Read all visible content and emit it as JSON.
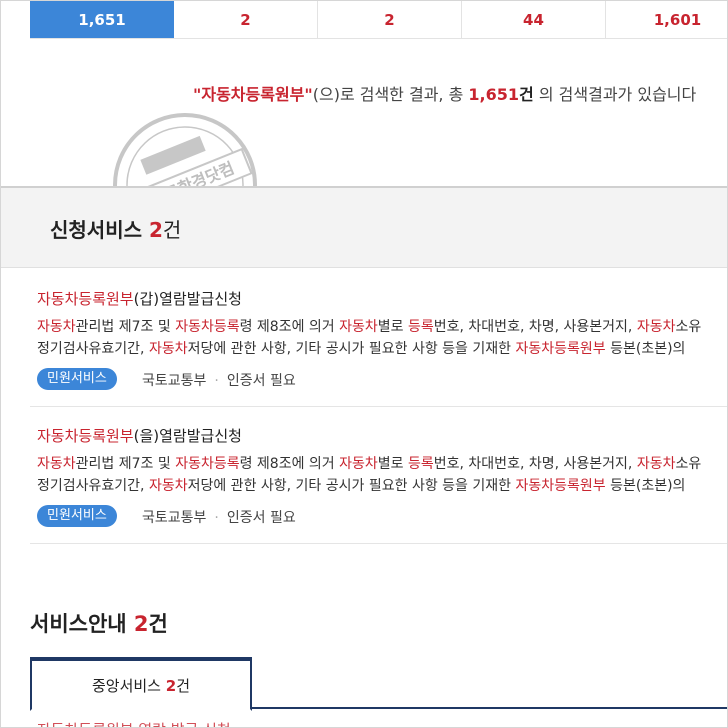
{
  "count_tabs": [
    "1,651",
    "2",
    "2",
    "44",
    "1,601"
  ],
  "summary": {
    "quote_open": "\"",
    "keyword": "자동차등록원부",
    "quote_close": "\"",
    "text1": "(으)로 검색한 결과, 총 ",
    "total": "1,651",
    "unit": "건",
    "text2": " 의 검색결과가 있습니다"
  },
  "watermark_text": "블로그한경닷컴",
  "apply_section": {
    "title": "신청서비스",
    "count": "2",
    "unit": "건"
  },
  "items": [
    {
      "title_hl": "자동차등록원부",
      "title_rest": "(갑)열람발급신청",
      "line1": [
        {
          "t": "자동차",
          "h": true
        },
        {
          "t": "관리법 제7조 및 ",
          "h": false
        },
        {
          "t": "자동차등록",
          "h": true
        },
        {
          "t": "령 제8조에 의거 ",
          "h": false
        },
        {
          "t": "자동차",
          "h": true
        },
        {
          "t": "별로 ",
          "h": false
        },
        {
          "t": "등록",
          "h": true
        },
        {
          "t": "번호, 차대번호, 차명, 사용본거지, ",
          "h": false
        },
        {
          "t": "자동차",
          "h": true
        },
        {
          "t": "소유",
          "h": false
        }
      ],
      "line2": [
        {
          "t": "정기검사유효기간, ",
          "h": false
        },
        {
          "t": "자동차",
          "h": true
        },
        {
          "t": "저당에 관한 사항, 기타 공시가 필요한 사항 등을 기재한 ",
          "h": false
        },
        {
          "t": "자동차등록원부",
          "h": true
        },
        {
          "t": " 등본(초본)의",
          "h": false
        }
      ],
      "badge": "민원서비스",
      "agency": "국토교통부",
      "cert": "인증서 필요"
    },
    {
      "title_hl": "자동차등록원부",
      "title_rest": "(을)열람발급신청",
      "line1": [
        {
          "t": "자동차",
          "h": true
        },
        {
          "t": "관리법 제7조 및 ",
          "h": false
        },
        {
          "t": "자동차등록",
          "h": true
        },
        {
          "t": "령 제8조에 의거 ",
          "h": false
        },
        {
          "t": "자동차",
          "h": true
        },
        {
          "t": "별로 ",
          "h": false
        },
        {
          "t": "등록",
          "h": true
        },
        {
          "t": "번호, 차대번호, 차명, 사용본거지, ",
          "h": false
        },
        {
          "t": "자동차",
          "h": true
        },
        {
          "t": "소유",
          "h": false
        }
      ],
      "line2": [
        {
          "t": "정기검사유효기간, ",
          "h": false
        },
        {
          "t": "자동차",
          "h": true
        },
        {
          "t": "저당에 관한 사항, 기타 공시가 필요한 사항 등을 기재한 ",
          "h": false
        },
        {
          "t": "자동차등록원부",
          "h": true
        },
        {
          "t": " 등본(초본)의",
          "h": false
        }
      ],
      "badge": "민원서비스",
      "agency": "국토교통부",
      "cert": "인증서 필요"
    }
  ],
  "guide_section": {
    "title": "서비스안내",
    "count": "2",
    "unit": "건"
  },
  "tab": {
    "label": "중앙서비스",
    "count": "2",
    "unit": "건"
  },
  "next_partial": "자동차등록원부 열람 발급 신청",
  "colors": {
    "accent_blue": "#3c86d8",
    "highlight_red": "#c8242f",
    "navy": "#1f3864"
  }
}
